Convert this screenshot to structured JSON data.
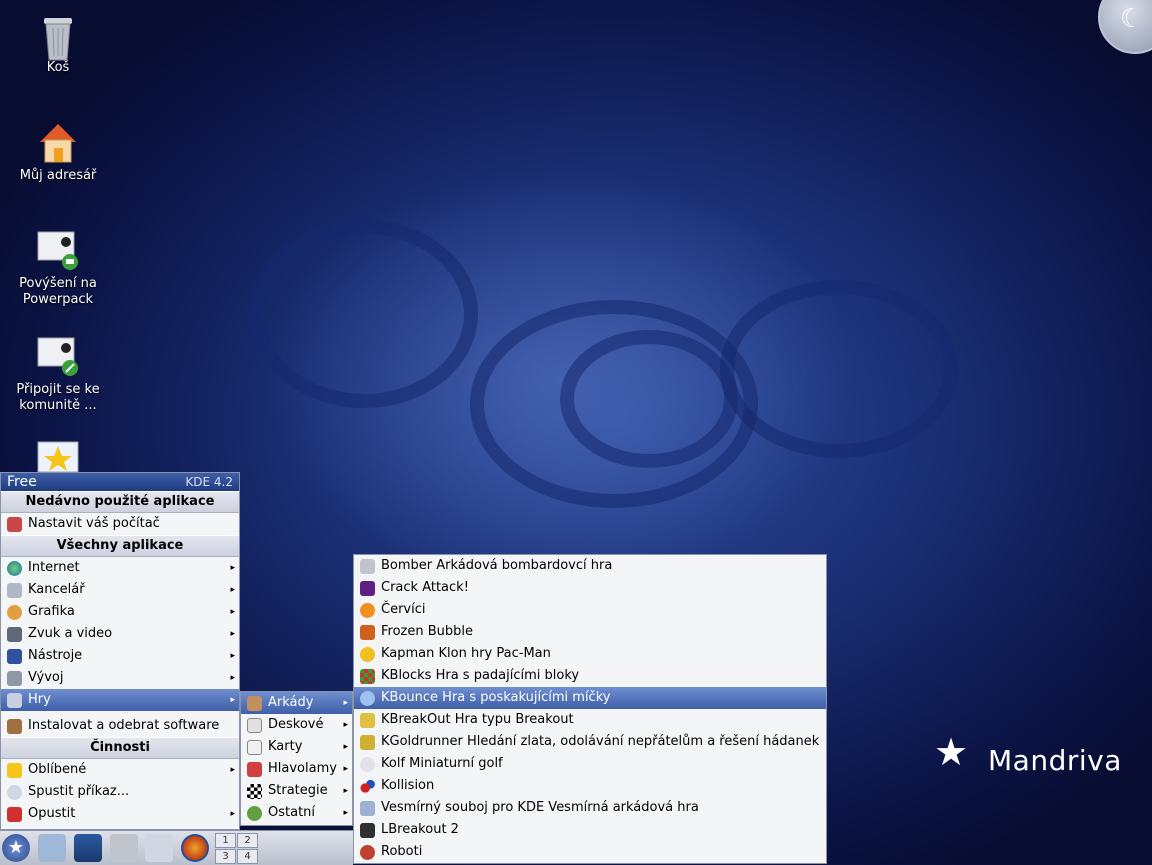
{
  "desktop": {
    "icons": [
      {
        "label": "Koš",
        "icon": "trash-icon"
      },
      {
        "label": "Můj adresář",
        "icon": "home-folder-icon"
      },
      {
        "label": "Povýšení na Powerpack",
        "icon": "upgrade-powerpack-icon"
      },
      {
        "label": "Připojit se ke komunitě ...",
        "icon": "join-community-icon"
      },
      {
        "label": "",
        "icon": "favorites-star-icon"
      }
    ],
    "logo": "Mandriva"
  },
  "menu": {
    "header_left": "Free",
    "header_right": "KDE 4.2",
    "section_recent": "Nedávno použité aplikace",
    "recent_items": [
      {
        "label": "Nastavit váš počítač",
        "icon": "configure-computer-icon"
      }
    ],
    "section_all": "Všechny aplikace",
    "categories": [
      {
        "label": "Internet",
        "icon": "globe-icon"
      },
      {
        "label": "Kancelář",
        "icon": "office-icon"
      },
      {
        "label": "Grafika",
        "icon": "graphics-palette-icon"
      },
      {
        "label": "Zvuk a video",
        "icon": "multimedia-icon"
      },
      {
        "label": "Nástroje",
        "icon": "tools-icon"
      },
      {
        "label": "Vývoj",
        "icon": "development-icon"
      },
      {
        "label": "Hry",
        "icon": "games-icon"
      }
    ],
    "install_item": "Instalovat a odebrat software",
    "section_actions": "Činnosti",
    "actions": [
      {
        "label": "Oblíbené",
        "icon": "favorites-star-icon",
        "submenu": true
      },
      {
        "label": "Spustit příkaz...",
        "icon": "run-command-icon",
        "submenu": false
      },
      {
        "label": "Opustit",
        "icon": "power-icon",
        "submenu": true
      }
    ]
  },
  "games_submenu": [
    {
      "label": "Arkády",
      "icon": "arcade-icon"
    },
    {
      "label": "Deskové",
      "icon": "board-games-icon"
    },
    {
      "label": "Karty",
      "icon": "cards-icon"
    },
    {
      "label": "Hlavolamy",
      "icon": "puzzle-icon"
    },
    {
      "label": "Strategie",
      "icon": "strategy-icon"
    },
    {
      "label": "Ostatní",
      "icon": "other-games-icon"
    }
  ],
  "arcade_submenu": [
    {
      "label": "Bomber Arkádová bombardovcí hra",
      "icon": "bomber-icon"
    },
    {
      "label": "Crack Attack!",
      "icon": "crack-attack-icon"
    },
    {
      "label": "Červíci",
      "icon": "worms-icon"
    },
    {
      "label": "Frozen Bubble",
      "icon": "frozen-bubble-icon"
    },
    {
      "label": "Kapman Klon hry Pac-Man",
      "icon": "kapman-icon"
    },
    {
      "label": "KBlocks Hra s padajícími bloky",
      "icon": "kblocks-icon"
    },
    {
      "label": "KBounce Hra s poskakujícími míčky",
      "icon": "kbounce-icon"
    },
    {
      "label": "KBreakOut Hra typu Breakout",
      "icon": "kbreakout-icon"
    },
    {
      "label": "KGoldrunner Hledání zlata, odolávání nepřátelům a řešení hádanek",
      "icon": "kgoldrunner-icon"
    },
    {
      "label": "Kolf Miniaturní golf",
      "icon": "kolf-icon"
    },
    {
      "label": "Kollision",
      "icon": "kollision-icon"
    },
    {
      "label": "Vesmírný souboj pro KDE Vesmírná arkádová hra",
      "icon": "kspaceduel-icon"
    },
    {
      "label": "LBreakout 2",
      "icon": "lbreakout-icon"
    },
    {
      "label": "Roboti",
      "icon": "robots-icon"
    }
  ],
  "taskbar": {
    "pager": [
      "1",
      "2",
      "3",
      "4"
    ]
  },
  "colors": {
    "selection": "#3e5fa8",
    "menu_bg": "#f4f5f7"
  }
}
